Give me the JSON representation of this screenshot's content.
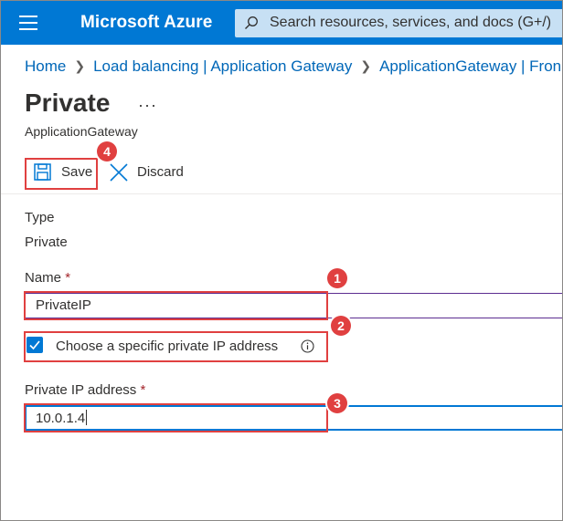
{
  "header": {
    "brand": "Microsoft Azure",
    "search_placeholder": "Search resources, services, and docs (G+/)"
  },
  "breadcrumb": {
    "items": [
      "Home",
      "Load balancing | Application Gateway",
      "ApplicationGateway | Fron"
    ]
  },
  "page": {
    "title": "Private",
    "more": "···",
    "subtitle": "ApplicationGateway"
  },
  "toolbar": {
    "save_label": "Save",
    "discard_label": "Discard"
  },
  "form": {
    "type_label": "Type",
    "type_value": "Private",
    "name_label": "Name",
    "required_mark": "*",
    "name_value": "PrivateIP",
    "checkbox_label": "Choose a specific private IP address",
    "checkbox_checked": true,
    "ip_label": "Private IP address",
    "ip_value": "10.0.1.4"
  },
  "annotations": [
    "1",
    "2",
    "3",
    "4"
  ],
  "colors": {
    "accent": "#0078d4",
    "annotation": "#e04040",
    "link": "#0067b8"
  }
}
